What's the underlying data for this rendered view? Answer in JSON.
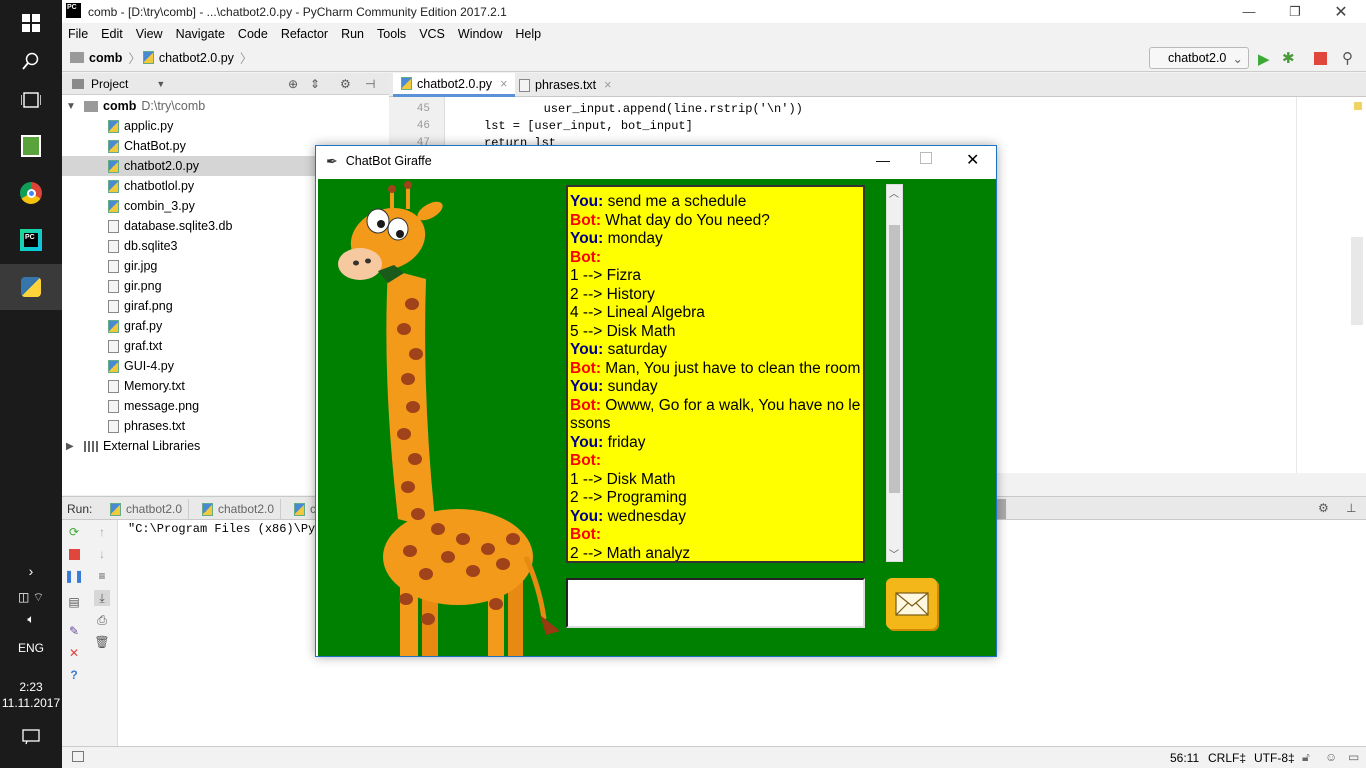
{
  "taskbar": {
    "tray": {
      "lang": "ENG",
      "time": "2:23",
      "date": "11.11.2017"
    }
  },
  "window": {
    "title": "comb - [D:\\try\\comb] - ...\\chatbot2.0.py - PyCharm Community Edition 2017.2.1"
  },
  "menu": [
    "File",
    "Edit",
    "View",
    "Navigate",
    "Code",
    "Refactor",
    "Run",
    "Tools",
    "VCS",
    "Window",
    "Help"
  ],
  "breadcrumb": {
    "project": "comb",
    "file": "chatbot2.0.py"
  },
  "run_config": "chatbot2.0",
  "project_panel": {
    "title": "Project",
    "root": {
      "name": "comb",
      "path": "D:\\try\\comb"
    },
    "files": [
      "applic.py",
      "ChatBot.py",
      "chatbot2.0.py",
      "chatbotlol.py",
      "combin_3.py",
      "database.sqlite3.db",
      "db.sqlite3",
      "gir.jpg",
      "gir.png",
      "giraf.png",
      "graf.py",
      "graf.txt",
      "GUI-4.py",
      "Memory.txt",
      "message.png",
      "phrases.txt"
    ],
    "external": "External Libraries"
  },
  "editor": {
    "tabs": [
      "chatbot2.0.py",
      "phrases.txt"
    ],
    "lines": [
      {
        "n": "45",
        "code": "        user_input.append(line.rstrip('\\n'))"
      },
      {
        "n": "46",
        "code": "lst = [user_input, bot_input]"
      },
      {
        "n": "47",
        "code": "return lst"
      }
    ]
  },
  "run_panel": {
    "label": "Run:",
    "tabs": [
      "chatbot2.0",
      "chatbot2.0",
      "c"
    ],
    "output": "\"C:\\Program Files (x86)\\Pyt"
  },
  "statusbar": {
    "pos": "56:11",
    "eol": "CRLF‡",
    "enc": "UTF-8‡"
  },
  "chatbot": {
    "title": "ChatBot Giraffe",
    "messages": [
      {
        "who": "You:",
        "text": " send me a schedule"
      },
      {
        "who": "Bot:",
        "text": " What day do You need?"
      },
      {
        "who": "You:",
        "text": " monday"
      },
      {
        "who": "Bot:",
        "text": ""
      },
      {
        "who": "",
        "text": "1 --> Fizra"
      },
      {
        "who": "",
        "text": "2 --> History"
      },
      {
        "who": "",
        "text": "4 --> Lineal Algebra"
      },
      {
        "who": "",
        "text": "5 --> Disk Math"
      },
      {
        "who": "You:",
        "text": " saturday"
      },
      {
        "who": "Bot:",
        "text": " Man, You just have to clean the room"
      },
      {
        "who": "You:",
        "text": " sunday"
      },
      {
        "who": "Bot:",
        "text": " Owww, Go for a walk, You have no lessons"
      },
      {
        "who": "You:",
        "text": " friday"
      },
      {
        "who": "Bot:",
        "text": ""
      },
      {
        "who": "",
        "text": "1 --> Disk Math"
      },
      {
        "who": "",
        "text": "2 --> Programing"
      },
      {
        "who": "You:",
        "text": " wednesday"
      },
      {
        "who": "Bot:",
        "text": ""
      },
      {
        "who": "",
        "text": "2 --> Math analyz"
      }
    ],
    "input_value": ""
  }
}
